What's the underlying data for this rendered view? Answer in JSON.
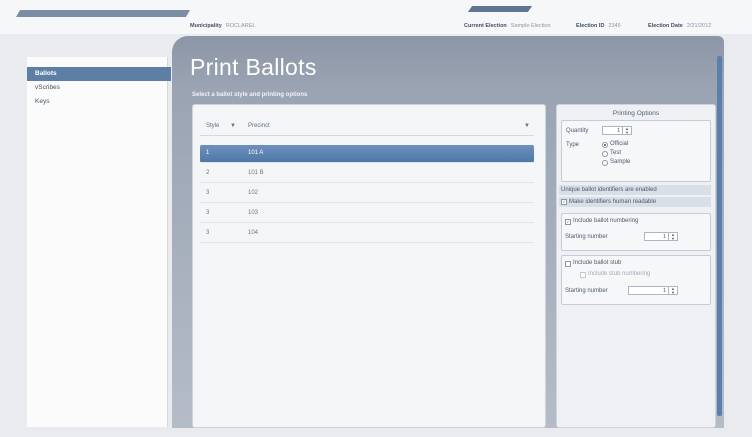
{
  "header": {
    "municipality_label": "Municipality",
    "municipality_value": "ROCLAREL",
    "current_election_label": "Current Election",
    "current_election_value": "Sample Election",
    "election_id_label": "Election ID",
    "election_id_value": "2345",
    "election_date_label": "Election Date",
    "election_date_value": "2/21/2012"
  },
  "sidebar": {
    "items": [
      {
        "label": "Ballots",
        "active": true
      },
      {
        "label": "vScribes",
        "active": false
      },
      {
        "label": "Keys",
        "active": false
      }
    ]
  },
  "page": {
    "title": "Print Ballots",
    "subtitle": "Select a ballot style and printing options"
  },
  "table": {
    "columns": [
      "Style",
      "Precinct"
    ],
    "rows": [
      {
        "style": "1",
        "precinct": "101 A",
        "selected": true
      },
      {
        "style": "2",
        "precinct": "101 B",
        "selected": false
      },
      {
        "style": "3",
        "precinct": "102",
        "selected": false
      },
      {
        "style": "3",
        "precinct": "103",
        "selected": false
      },
      {
        "style": "3",
        "precinct": "104",
        "selected": false
      }
    ]
  },
  "options": {
    "title": "Printing Options",
    "quantity_label": "Quantity",
    "quantity_value": "1",
    "type_label": "Type",
    "type_options": [
      "Official",
      "Test",
      "Sample"
    ],
    "type_selected": "Official",
    "unique_identifiers_text": "Unique ballot identifiers are enabled",
    "human_readable_label": "Make identifiers human readable",
    "human_readable_checked": true,
    "include_numbering_label": "Include ballot numbering",
    "include_numbering_checked": true,
    "starting_number_label": "Starting number",
    "starting_number_value": "1",
    "include_stub_label": "Include ballot stub",
    "include_stub_checked": false,
    "include_stub_numbering_label": "Include stub numbering",
    "stub_starting_number_label": "Starting number",
    "stub_starting_number_value": "1"
  },
  "colors": {
    "accent": "#5d7fa6",
    "header_gradient_top": "#8c96a6",
    "selected_row": "#5a80ae"
  }
}
